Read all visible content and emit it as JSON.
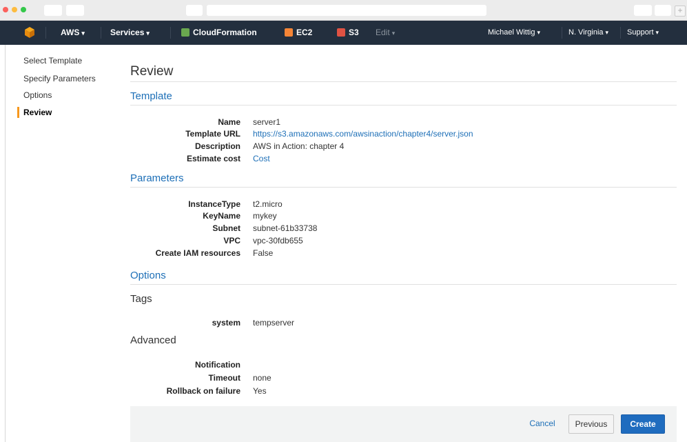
{
  "colors": {
    "nav_bg": "#232f3e",
    "accent_link": "#1d6fb7",
    "active_indicator": "#f7981d",
    "create_button": "#1f6cbf"
  },
  "nav": {
    "aws": "AWS",
    "services": "Services",
    "cloudformation": "CloudFormation",
    "ec2": "EC2",
    "s3": "S3",
    "edit": "Edit",
    "user": "Michael Wittig",
    "region": "N. Virginia",
    "support": "Support",
    "caret": "▾",
    "icons": [
      "aws-cube-icon",
      "cloudformation-icon",
      "ec2-icon",
      "s3-icon"
    ]
  },
  "sidebar": {
    "items": [
      {
        "label": "Select Template"
      },
      {
        "label": "Specify Parameters"
      },
      {
        "label": "Options"
      },
      {
        "label": "Review"
      }
    ]
  },
  "main": {
    "title": "Review",
    "template": {
      "title": "Template",
      "rows": [
        {
          "label": "Name",
          "value": "server1"
        },
        {
          "label": "Template URL",
          "value": "https://s3.amazonaws.com/awsinaction/chapter4/server.json"
        },
        {
          "label": "Description",
          "value": "AWS in Action: chapter 4"
        },
        {
          "label": "Estimate cost",
          "value": "Cost"
        }
      ]
    },
    "parameters": {
      "title": "Parameters",
      "rows": [
        {
          "label": "InstanceType",
          "value": "t2.micro"
        },
        {
          "label": "KeyName",
          "value": "mykey"
        },
        {
          "label": "Subnet",
          "value": "subnet-61b33738"
        },
        {
          "label": "VPC",
          "value": "vpc-30fdb655"
        },
        {
          "label": "Create IAM resources",
          "value": "False"
        }
      ]
    },
    "options": {
      "title": "Options",
      "tags_title": "Tags",
      "tags": [
        {
          "label": "system",
          "value": "tempserver"
        }
      ],
      "advanced_title": "Advanced",
      "advanced": [
        {
          "label": "Notification",
          "value": ""
        },
        {
          "label": "Timeout",
          "value": "none"
        },
        {
          "label": "Rollback on failure",
          "value": "Yes"
        }
      ]
    }
  },
  "footer": {
    "cancel": "Cancel",
    "previous": "Previous",
    "create": "Create"
  }
}
